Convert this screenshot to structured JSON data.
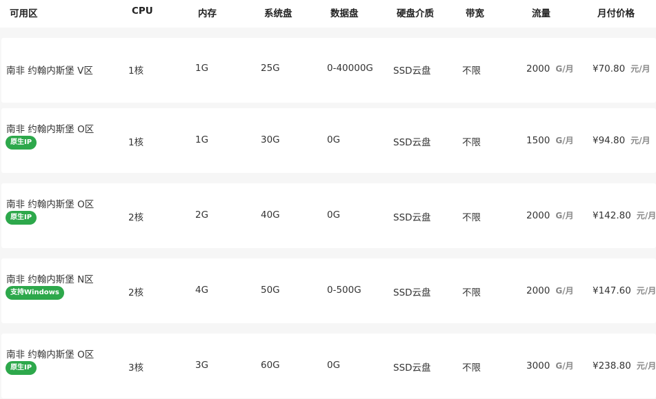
{
  "header": {
    "zone": "可用区",
    "cpu": "CPU",
    "memory": "内存",
    "system_disk": "系统盘",
    "data_disk": "数据盘",
    "disk_medium": "硬盘介质",
    "bandwidth": "带宽",
    "traffic": "流量",
    "monthly_price": "月付价格"
  },
  "units": {
    "traffic": "G/月",
    "price": "元/月"
  },
  "rows": [
    {
      "zone": "南非 约翰内斯堡 V区",
      "badge": "",
      "cpu": "1核",
      "memory": "1G",
      "system_disk": "25G",
      "data_disk": "0-40000G",
      "disk_medium": "SSD云盘",
      "bandwidth": "不限",
      "traffic": "2000",
      "price": "¥70.80"
    },
    {
      "zone": "南非 约翰内斯堡 O区",
      "badge": "原生IP",
      "cpu": "1核",
      "memory": "1G",
      "system_disk": "30G",
      "data_disk": "0G",
      "disk_medium": "SSD云盘",
      "bandwidth": "不限",
      "traffic": "1500",
      "price": "¥94.80"
    },
    {
      "zone": "南非 约翰内斯堡 O区",
      "badge": "原生IP",
      "cpu": "2核",
      "memory": "2G",
      "system_disk": "40G",
      "data_disk": "0G",
      "disk_medium": "SSD云盘",
      "bandwidth": "不限",
      "traffic": "2000",
      "price": "¥142.80"
    },
    {
      "zone": "南非 约翰内斯堡 N区",
      "badge": "支持Windows",
      "cpu": "2核",
      "memory": "4G",
      "system_disk": "50G",
      "data_disk": "0-500G",
      "disk_medium": "SSD云盘",
      "bandwidth": "不限",
      "traffic": "2000",
      "price": "¥147.60"
    },
    {
      "zone": "南非 约翰内斯堡 O区",
      "badge": "原生IP",
      "cpu": "3核",
      "memory": "3G",
      "system_disk": "60G",
      "data_disk": "0G",
      "disk_medium": "SSD云盘",
      "bandwidth": "不限",
      "traffic": "3000",
      "price": "¥238.80"
    }
  ]
}
